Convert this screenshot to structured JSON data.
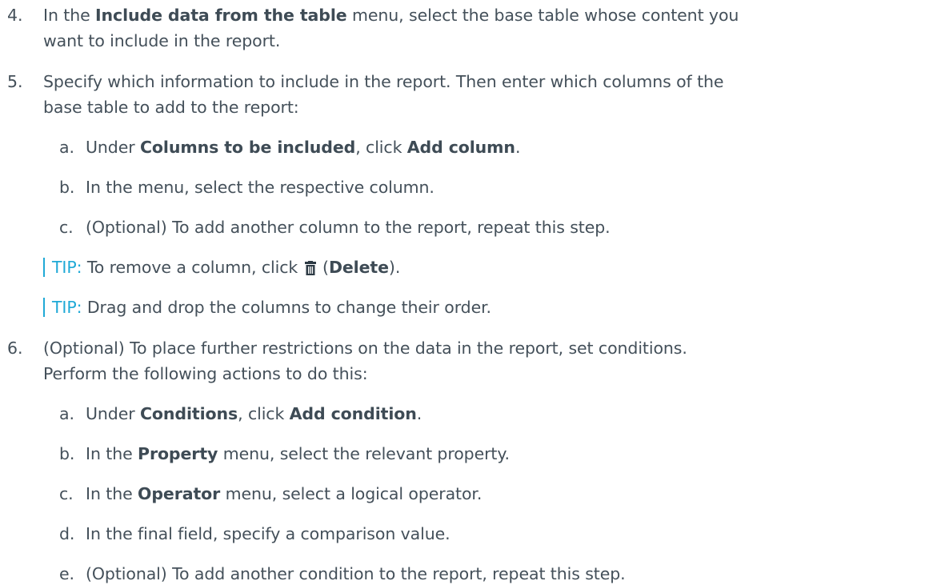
{
  "steps": [
    {
      "num": "4.",
      "lines": [
        {
          "pre": "In the ",
          "b1": "Include data from the table",
          "post": " menu, select the base table whose content you"
        },
        {
          "text": "want to include in the report."
        }
      ]
    },
    {
      "num": "5.",
      "lines": [
        {
          "text": "Specify which information to include in the report. Then enter which columns of the"
        },
        {
          "text": "base table to add to the report:"
        }
      ],
      "substeps": [
        {
          "letter": "a.",
          "pre": "Under ",
          "b1": "Columns to be included",
          "mid": ", click ",
          "b2": "Add column",
          "post": "."
        },
        {
          "letter": "b.",
          "text": "In the menu, select the respective column."
        },
        {
          "letter": "c.",
          "text": "(Optional) To add another column to the report, repeat this step."
        }
      ],
      "tips": [
        {
          "label": "TIP:",
          "pre": " To remove a column, click ",
          "icon": "trash-icon",
          "mid": " (",
          "b1": "Delete",
          "post": ")."
        },
        {
          "label": "TIP:",
          "text": " Drag and drop the columns to change their order."
        }
      ]
    },
    {
      "num": "6.",
      "lines": [
        {
          "text": "(Optional) To place further restrictions on the data in the report, set conditions."
        },
        {
          "text": "Perform the following actions to do this:"
        }
      ],
      "substeps": [
        {
          "letter": "a.",
          "pre": "Under ",
          "b1": "Conditions",
          "mid": ", click ",
          "b2": "Add condition",
          "post": "."
        },
        {
          "letter": "b.",
          "pre": "In the ",
          "b1": "Property",
          "post": " menu, select the relevant property."
        },
        {
          "letter": "c.",
          "pre": "In the ",
          "b1": "Operator",
          "post": " menu, select a logical operator."
        },
        {
          "letter": "d.",
          "text": "In the final field, specify a comparison value."
        },
        {
          "letter": "e.",
          "text": "(Optional) To add another condition to the report, repeat this step."
        }
      ]
    }
  ],
  "colors": {
    "text": "#44505a",
    "tip": "#1fa9d6"
  }
}
